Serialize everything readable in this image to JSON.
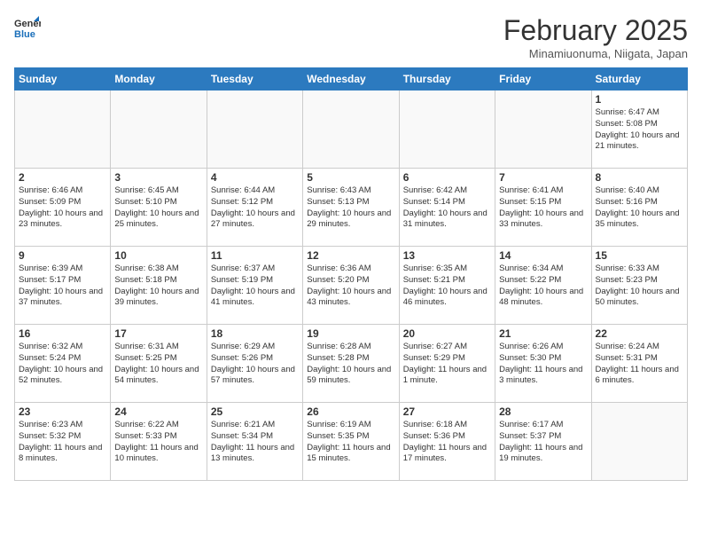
{
  "header": {
    "logo_general": "General",
    "logo_blue": "Blue",
    "title": "February 2025",
    "subtitle": "Minamiuonuma, Niigata, Japan"
  },
  "days_of_week": [
    "Sunday",
    "Monday",
    "Tuesday",
    "Wednesday",
    "Thursday",
    "Friday",
    "Saturday"
  ],
  "weeks": [
    [
      {
        "day": "",
        "info": ""
      },
      {
        "day": "",
        "info": ""
      },
      {
        "day": "",
        "info": ""
      },
      {
        "day": "",
        "info": ""
      },
      {
        "day": "",
        "info": ""
      },
      {
        "day": "",
        "info": ""
      },
      {
        "day": "1",
        "info": "Sunrise: 6:47 AM\nSunset: 5:08 PM\nDaylight: 10 hours and 21 minutes."
      }
    ],
    [
      {
        "day": "2",
        "info": "Sunrise: 6:46 AM\nSunset: 5:09 PM\nDaylight: 10 hours and 23 minutes."
      },
      {
        "day": "3",
        "info": "Sunrise: 6:45 AM\nSunset: 5:10 PM\nDaylight: 10 hours and 25 minutes."
      },
      {
        "day": "4",
        "info": "Sunrise: 6:44 AM\nSunset: 5:12 PM\nDaylight: 10 hours and 27 minutes."
      },
      {
        "day": "5",
        "info": "Sunrise: 6:43 AM\nSunset: 5:13 PM\nDaylight: 10 hours and 29 minutes."
      },
      {
        "day": "6",
        "info": "Sunrise: 6:42 AM\nSunset: 5:14 PM\nDaylight: 10 hours and 31 minutes."
      },
      {
        "day": "7",
        "info": "Sunrise: 6:41 AM\nSunset: 5:15 PM\nDaylight: 10 hours and 33 minutes."
      },
      {
        "day": "8",
        "info": "Sunrise: 6:40 AM\nSunset: 5:16 PM\nDaylight: 10 hours and 35 minutes."
      }
    ],
    [
      {
        "day": "9",
        "info": "Sunrise: 6:39 AM\nSunset: 5:17 PM\nDaylight: 10 hours and 37 minutes."
      },
      {
        "day": "10",
        "info": "Sunrise: 6:38 AM\nSunset: 5:18 PM\nDaylight: 10 hours and 39 minutes."
      },
      {
        "day": "11",
        "info": "Sunrise: 6:37 AM\nSunset: 5:19 PM\nDaylight: 10 hours and 41 minutes."
      },
      {
        "day": "12",
        "info": "Sunrise: 6:36 AM\nSunset: 5:20 PM\nDaylight: 10 hours and 43 minutes."
      },
      {
        "day": "13",
        "info": "Sunrise: 6:35 AM\nSunset: 5:21 PM\nDaylight: 10 hours and 46 minutes."
      },
      {
        "day": "14",
        "info": "Sunrise: 6:34 AM\nSunset: 5:22 PM\nDaylight: 10 hours and 48 minutes."
      },
      {
        "day": "15",
        "info": "Sunrise: 6:33 AM\nSunset: 5:23 PM\nDaylight: 10 hours and 50 minutes."
      }
    ],
    [
      {
        "day": "16",
        "info": "Sunrise: 6:32 AM\nSunset: 5:24 PM\nDaylight: 10 hours and 52 minutes."
      },
      {
        "day": "17",
        "info": "Sunrise: 6:31 AM\nSunset: 5:25 PM\nDaylight: 10 hours and 54 minutes."
      },
      {
        "day": "18",
        "info": "Sunrise: 6:29 AM\nSunset: 5:26 PM\nDaylight: 10 hours and 57 minutes."
      },
      {
        "day": "19",
        "info": "Sunrise: 6:28 AM\nSunset: 5:28 PM\nDaylight: 10 hours and 59 minutes."
      },
      {
        "day": "20",
        "info": "Sunrise: 6:27 AM\nSunset: 5:29 PM\nDaylight: 11 hours and 1 minute."
      },
      {
        "day": "21",
        "info": "Sunrise: 6:26 AM\nSunset: 5:30 PM\nDaylight: 11 hours and 3 minutes."
      },
      {
        "day": "22",
        "info": "Sunrise: 6:24 AM\nSunset: 5:31 PM\nDaylight: 11 hours and 6 minutes."
      }
    ],
    [
      {
        "day": "23",
        "info": "Sunrise: 6:23 AM\nSunset: 5:32 PM\nDaylight: 11 hours and 8 minutes."
      },
      {
        "day": "24",
        "info": "Sunrise: 6:22 AM\nSunset: 5:33 PM\nDaylight: 11 hours and 10 minutes."
      },
      {
        "day": "25",
        "info": "Sunrise: 6:21 AM\nSunset: 5:34 PM\nDaylight: 11 hours and 13 minutes."
      },
      {
        "day": "26",
        "info": "Sunrise: 6:19 AM\nSunset: 5:35 PM\nDaylight: 11 hours and 15 minutes."
      },
      {
        "day": "27",
        "info": "Sunrise: 6:18 AM\nSunset: 5:36 PM\nDaylight: 11 hours and 17 minutes."
      },
      {
        "day": "28",
        "info": "Sunrise: 6:17 AM\nSunset: 5:37 PM\nDaylight: 11 hours and 19 minutes."
      },
      {
        "day": "",
        "info": ""
      }
    ]
  ]
}
